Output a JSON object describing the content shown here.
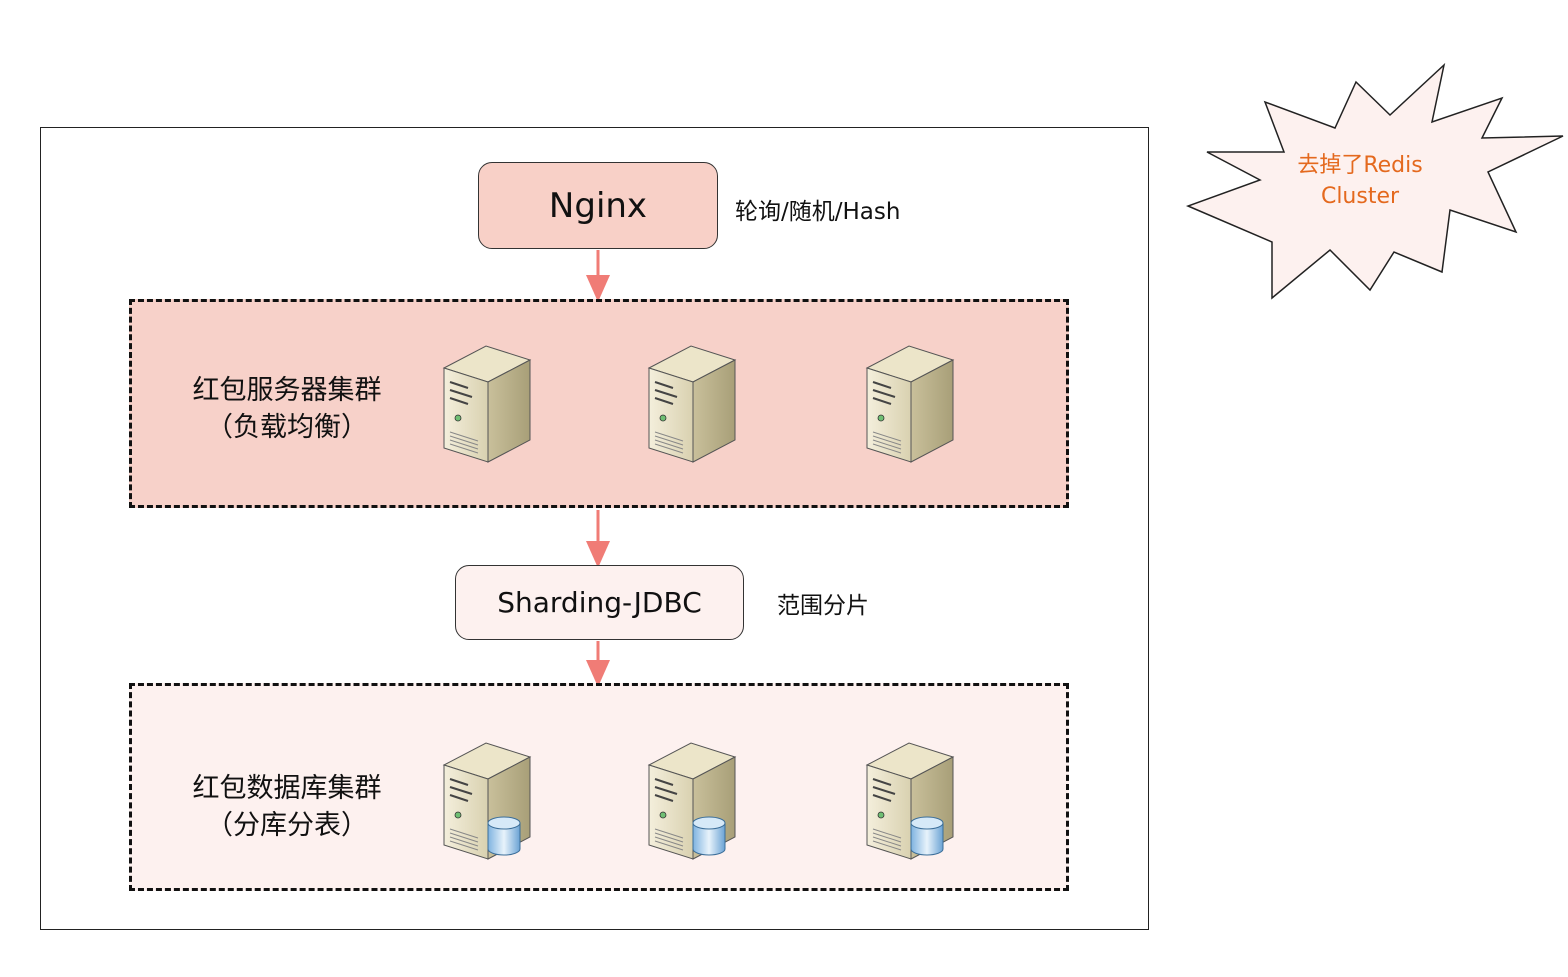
{
  "nginx": {
    "label": "Nginx",
    "note": "轮询/随机/Hash"
  },
  "server_cluster": {
    "title": "红包服务器集群",
    "subtitle": "（负载均衡）",
    "server_count": 3,
    "server_icon": "server-tower-icon"
  },
  "sharding": {
    "label": "Sharding-JDBC",
    "note": "范围分片"
  },
  "db_cluster": {
    "title": "红包数据库集群",
    "subtitle": "（分库分表）",
    "server_count": 3,
    "server_icon": "database-server-icon"
  },
  "callout": {
    "line1": "去掉了Redis",
    "line2": "Cluster"
  },
  "colors": {
    "arrow": "#f07c76",
    "nginx_fill": "#f8d0c7",
    "server_cluster_fill": "#f7d1c9",
    "db_cluster_fill": "#fdf1ef",
    "callout_text": "#e4691e"
  }
}
